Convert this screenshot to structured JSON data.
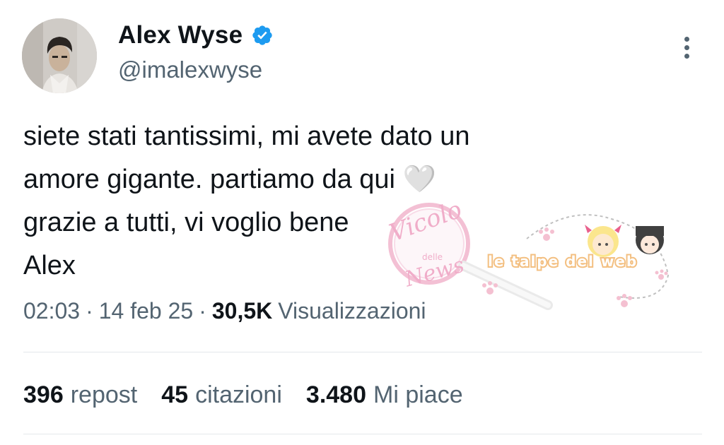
{
  "author": {
    "display_name": "Alex Wyse",
    "handle": "@imalexwyse",
    "verified": true
  },
  "tweet": {
    "text": "siete stati tantissimi, mi avete dato un\namore gigante. partiamo da qui 🤍\ngrazie a tutti, vi voglio bene\nAlex"
  },
  "meta": {
    "time": "02:03",
    "sep1": "·",
    "date": "14 feb 25",
    "sep2": "·",
    "views_count": "30,5K",
    "views_label": "Visualizzazioni"
  },
  "stats": {
    "reposts_count": "396",
    "reposts_label": "repost",
    "quotes_count": "45",
    "quotes_label": "citazioni",
    "likes_count": "3.480",
    "likes_label": "Mi piace"
  },
  "watermark": {
    "text1": "Vicolo",
    "text2": "delle",
    "text3": "News",
    "text4": "le talpe del web"
  },
  "colors": {
    "text_primary": "#0f1419",
    "text_secondary": "#536471",
    "verified_blue": "#1d9bf0",
    "divider": "#e4e8eb"
  },
  "icons": {
    "verified": "verified-badge-icon",
    "more": "more-vertical-icon"
  }
}
